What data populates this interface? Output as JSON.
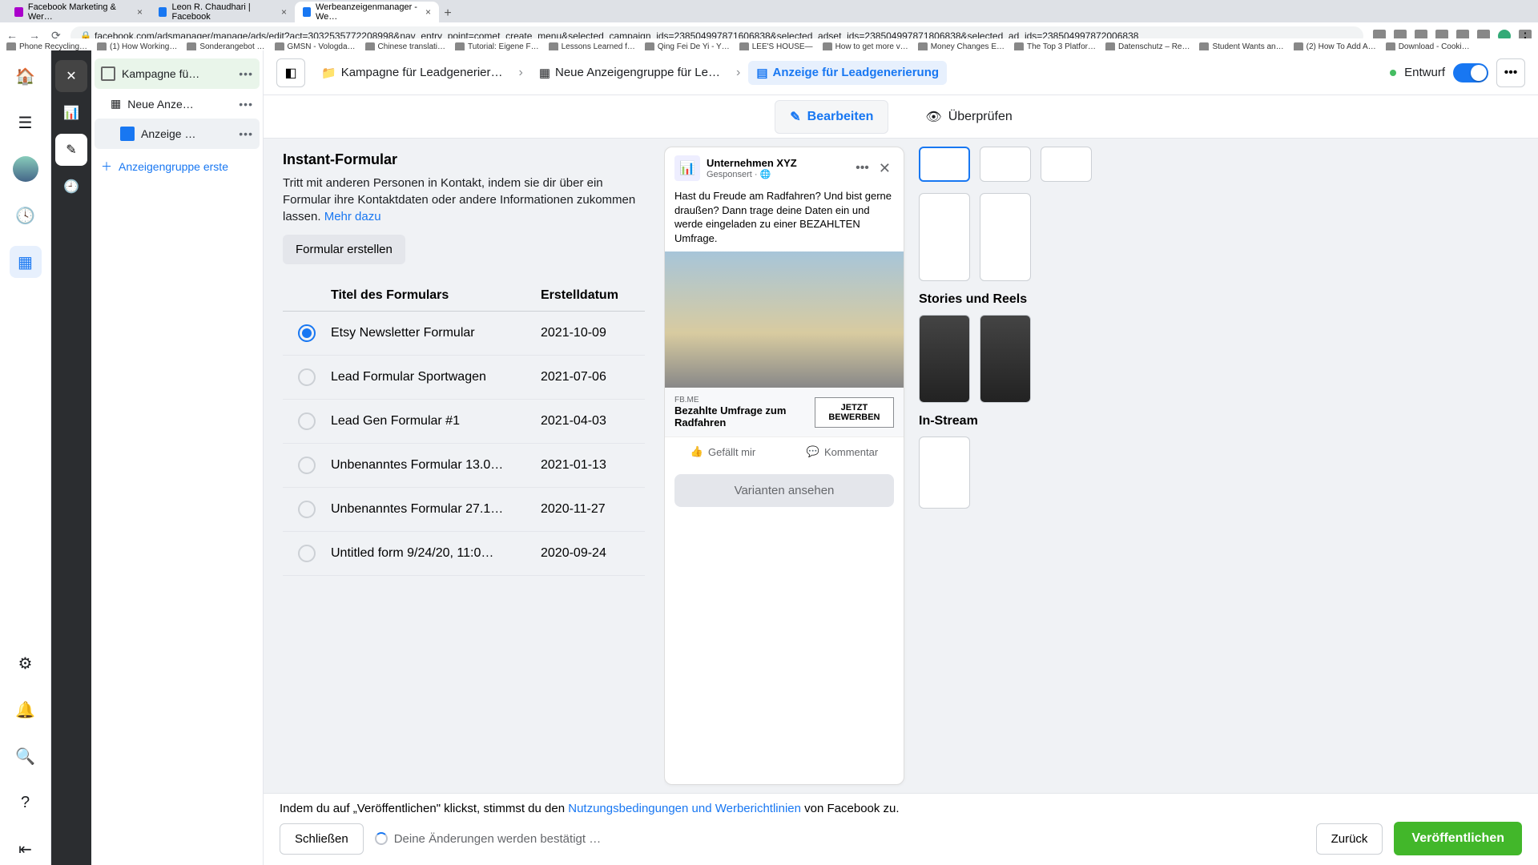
{
  "browser": {
    "tabs": [
      {
        "title": "Facebook Marketing & Wer…"
      },
      {
        "title": "Leon R. Chaudhari | Facebook"
      },
      {
        "title": "Werbeanzeigenmanager - We…"
      }
    ],
    "url": "facebook.com/adsmanager/manage/ads/edit?act=3032535772208998&nav_entry_point=comet_create_menu&selected_campaign_ids=238504997871606838&selected_adset_ids=238504997871806838&selected_ad_ids=238504997872006838",
    "bookmarks": [
      "Phone Recycling…",
      "(1) How Working…",
      "Sonderangebot …",
      "GMSN - Vologda…",
      "Chinese translati…",
      "Tutorial: Eigene F…",
      "Lessons Learned f…",
      "Qing Fei De Yi - Y…",
      "LEE'S HOUSE—",
      "How to get more v…",
      "Money Changes E…",
      "The Top 3 Platfor…",
      "Datenschutz – Re…",
      "Student Wants an…",
      "(2) How To Add A…",
      "Download - Cooki…"
    ]
  },
  "tree": {
    "campaign": "Kampagne fü…",
    "adset": "Neue Anze…",
    "ad": "Anzeige …",
    "add": "Anzeigengruppe erste"
  },
  "crumbs": {
    "a": "Kampagne für Leadgenerier…",
    "b": "Neue Anzeigengruppe für Le…",
    "c": "Anzeige für Leadgenerierung",
    "status": "Entwurf"
  },
  "subtabs": {
    "edit": "Bearbeiten",
    "review": "Überprüfen"
  },
  "instant_form": {
    "title": "Instant-Formular",
    "desc": "Tritt mit anderen Personen in Kontakt, indem sie dir über ein Formular ihre Kontaktdaten oder andere Informationen zukommen lassen. ",
    "more": "Mehr dazu",
    "create": "Formular erstellen",
    "col_title": "Titel des Formulars",
    "col_date": "Erstelldatum",
    "rows": [
      {
        "title": "Etsy Newsletter Formular",
        "date": "2021-10-09",
        "sel": true
      },
      {
        "title": "Lead Formular Sportwagen",
        "date": "2021-07-06",
        "sel": false
      },
      {
        "title": "Lead Gen Formular #1",
        "date": "2021-04-03",
        "sel": false
      },
      {
        "title": "Unbenanntes Formular 13.0…",
        "date": "2021-01-13",
        "sel": false
      },
      {
        "title": "Unbenanntes Formular 27.1…",
        "date": "2020-11-27",
        "sel": false
      },
      {
        "title": "Untitled form 9/24/20, 11:0…",
        "date": "2020-09-24",
        "sel": false
      }
    ]
  },
  "preview": {
    "name": "Unternehmen XYZ",
    "sponsored": "Gesponsert · 🌐",
    "text": "Hast du Freude am Radfahren? Und bist gerne draußen? Dann trage deine Daten ein und werde eingeladen zu einer BEZAHLTEN Umfrage.",
    "url": "FB.ME",
    "headline": "Bezahlte Umfrage zum Radfahren",
    "cta": "JETZT BEWERBEN",
    "like": "Gefällt mir",
    "comment": "Kommentar",
    "variants": "Varianten ansehen"
  },
  "placements": {
    "stories": "Stories und Reels",
    "instream": "In-Stream"
  },
  "footer": {
    "text1": "Indem du auf „Veröffentlichen\" klickst, stimmst du den ",
    "link": "Nutzungsbedingungen und Werberichtlinien",
    "text2": " von Facebook zu.",
    "close": "Schließen",
    "saving": "Deine Änderungen werden bestätigt …",
    "back": "Zurück",
    "publish": "Veröffentlichen"
  }
}
